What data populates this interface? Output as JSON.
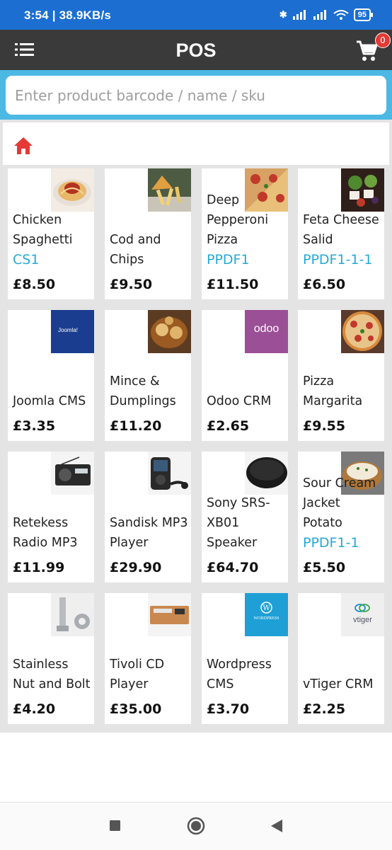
{
  "status_bar": {
    "time_speed": "3:54 | 38.9KB/s",
    "battery": "95"
  },
  "topbar": {
    "title": "POS",
    "cart_count": "0"
  },
  "search": {
    "placeholder": "Enter product barcode / name / sku"
  },
  "colors": {
    "status_bar": "#1c6fd1",
    "topbar": "#3a3a3a",
    "search_band": "#4cb8e4",
    "sku_text": "#26a9d4",
    "badge": "#e53935",
    "home_icon": "#e53935"
  },
  "products": [
    {
      "name": "Chicken Spaghetti",
      "sku": "CS1",
      "price": "£8.50",
      "thumb": "spaghetti-photo"
    },
    {
      "name": "Cod and Chips",
      "sku": "",
      "price": "£9.50",
      "thumb": "fish-chips-photo"
    },
    {
      "name": "Deep Pepperoni Pizza",
      "sku": "PPDF1",
      "price": "£11.50",
      "thumb": "pizza-photo"
    },
    {
      "name": "Feta Cheese Salid",
      "sku": "PPDF1-1-1",
      "price": "£6.50",
      "thumb": "salad-photo"
    },
    {
      "name": "Joomla CMS",
      "sku": "",
      "price": "£3.35",
      "thumb": "joomla-logo"
    },
    {
      "name": "Mince & Dumplings",
      "sku": "",
      "price": "£11.20",
      "thumb": "stew-photo"
    },
    {
      "name": "Odoo CRM",
      "sku": "",
      "price": "£2.65",
      "thumb": "odoo-logo"
    },
    {
      "name": "Pizza Margarita",
      "sku": "",
      "price": "£9.55",
      "thumb": "pizza-photo"
    },
    {
      "name": "Retekess Radio MP3",
      "sku": "",
      "price": "£11.99",
      "thumb": "radio-photo"
    },
    {
      "name": "Sandisk MP3 Player",
      "sku": "",
      "price": "£29.90",
      "thumb": "mp3-player-photo"
    },
    {
      "name": "Sony SRS-XB01 Speaker",
      "sku": "",
      "price": "£64.70",
      "thumb": "speaker-photo"
    },
    {
      "name": "Sour Cream Jacket Potato",
      "sku": "PPDF1-1",
      "price": "£5.50",
      "thumb": "potato-photo"
    },
    {
      "name": "Stainless Nut and Bolt",
      "sku": "",
      "price": "£4.20",
      "thumb": "bolt-photo"
    },
    {
      "name": "Tivoli CD Player",
      "sku": "",
      "price": "£35.00",
      "thumb": "cd-player-photo"
    },
    {
      "name": "Wordpress CMS",
      "sku": "",
      "price": "£3.70",
      "thumb": "wordpress-logo"
    },
    {
      "name": "vTiger CRM",
      "sku": "",
      "price": "£2.25",
      "thumb": "vtiger-logo"
    }
  ],
  "thumb_text": {
    "joomla": "Joomla!",
    "odoo": "odoo",
    "wordpress": "WORDPRESS",
    "vtiger": "vtiger"
  }
}
